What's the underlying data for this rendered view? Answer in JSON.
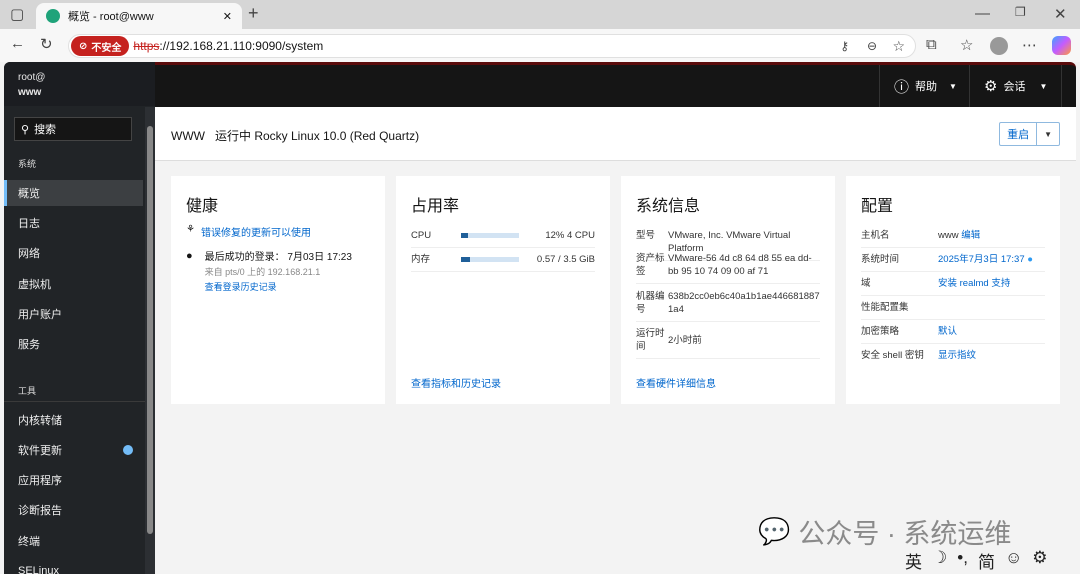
{
  "browser": {
    "tab_title": "概览 - root@www",
    "insecure_label": "不安全",
    "url_scheme": "https",
    "url_rest": "://192.168.21.110:9090/system"
  },
  "sidebar": {
    "user": "root@",
    "host": "www",
    "search_placeholder": "搜索",
    "section_system": "系统",
    "section_tools": "工具",
    "items": [
      {
        "label": "概览",
        "active": true
      },
      {
        "label": "日志"
      },
      {
        "label": "网络"
      },
      {
        "label": "虚拟机"
      },
      {
        "label": "用户账户"
      },
      {
        "label": "服务"
      }
    ],
    "tools": [
      {
        "label": "内核转储"
      },
      {
        "label": "软件更新",
        "badge": true
      },
      {
        "label": "应用程序"
      },
      {
        "label": "诊断报告"
      },
      {
        "label": "终端"
      },
      {
        "label": "SELinux"
      }
    ]
  },
  "topbar": {
    "help": "帮助",
    "session": "会话"
  },
  "header": {
    "host": "WWW",
    "status": "运行中 Rocky Linux 10.0 (Red Quartz)",
    "restart": "重启"
  },
  "health": {
    "title": "健康",
    "updates": "错误修复的更新可以使用",
    "last_login": "最后成功的登录： 7月03日 17:23",
    "from": "来自 pts/0 上的 192.168.21.1",
    "history": "查看登录历史记录"
  },
  "usage": {
    "title": "占用率",
    "cpu_label": "CPU",
    "cpu_value": "12% 4 CPU",
    "cpu_percent": 12,
    "mem_label": "内存",
    "mem_value": "0.57 / 3.5 GiB",
    "mem_percent": 16,
    "link": "查看指标和历史记录"
  },
  "sysinfo": {
    "title": "系统信息",
    "rows": [
      {
        "k": "型号",
        "v": "VMware, Inc. VMware Virtual Platform"
      },
      {
        "k": "资产标签",
        "v": "VMware-56 4d c8 64 d8 55 ea dd-bb 95 10 74 09 00 af 71"
      },
      {
        "k": "机器编号",
        "v": "638b2cc0eb6c40a1b1ae446681887 1a4"
      },
      {
        "k": "运行时间",
        "v": "2小时前"
      }
    ],
    "link": "查看硬件详细信息"
  },
  "config": {
    "title": "配置",
    "rows": [
      {
        "k": "主机名",
        "v": "www",
        "link": "编辑"
      },
      {
        "k": "系统时间",
        "link": "2025年7月3日 17:37"
      },
      {
        "k": "域",
        "link": "安装 realmd 支持"
      },
      {
        "k": "性能配置集"
      },
      {
        "k": "加密策略",
        "link": "默认"
      },
      {
        "k": "安全 shell 密钥",
        "link": "显示指纹"
      }
    ]
  },
  "watermark": "公众号 · 系统运维",
  "ime": [
    "英",
    "☽",
    "•,",
    "简",
    "☺",
    "⚙"
  ],
  "colors": {
    "accent": "#0066cc",
    "sidebar": "#212427",
    "topbar": "#151515",
    "insecure": "#c5221f"
  }
}
